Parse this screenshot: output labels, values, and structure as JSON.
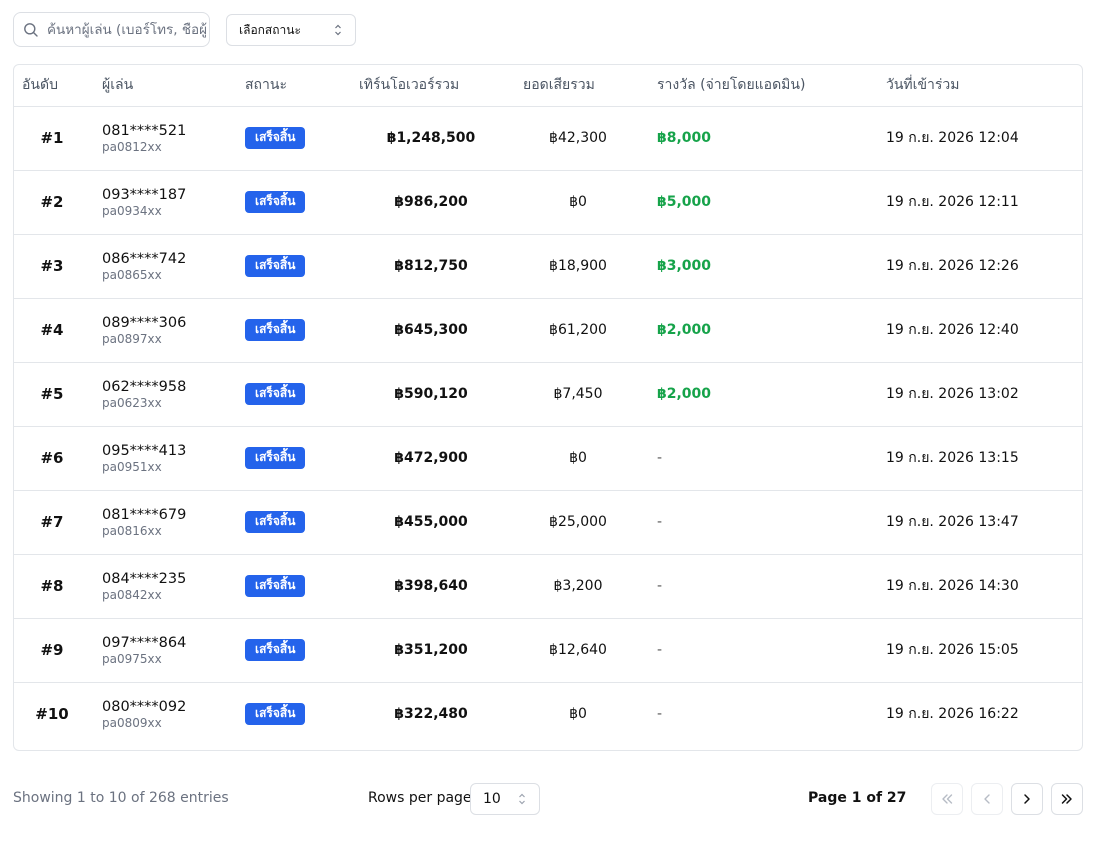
{
  "search": {
    "placeholder": "ค้นหาผู้เล่น (เบอร์โทร, ชื่อผู้ใช้)"
  },
  "status_filter": {
    "label": "เลือกสถานะ"
  },
  "table": {
    "headers": {
      "rank": "อันดับ",
      "player": "ผู้เล่น",
      "status": "สถานะ",
      "turnover": "เทิร์นโอเวอร์รวม",
      "loss": "ยอดเสียรวม",
      "prize": "รางวัล (จ่ายโดยแอดมิน)",
      "joined": "วันที่เข้าร่วม"
    },
    "rows": [
      {
        "rank": "#1",
        "phone": "081****521",
        "username": "pa0812xx",
        "status": "เสร็จสิ้น",
        "turnover": "฿1,248,500",
        "loss": "฿42,300",
        "prize": "฿8,000",
        "joined": "19 ก.ย. 2026 12:04"
      },
      {
        "rank": "#2",
        "phone": "093****187",
        "username": "pa0934xx",
        "status": "เสร็จสิ้น",
        "turnover": "฿986,200",
        "loss": "฿0",
        "prize": "฿5,000",
        "joined": "19 ก.ย. 2026 12:11"
      },
      {
        "rank": "#3",
        "phone": "086****742",
        "username": "pa0865xx",
        "status": "เสร็จสิ้น",
        "turnover": "฿812,750",
        "loss": "฿18,900",
        "prize": "฿3,000",
        "joined": "19 ก.ย. 2026 12:26"
      },
      {
        "rank": "#4",
        "phone": "089****306",
        "username": "pa0897xx",
        "status": "เสร็จสิ้น",
        "turnover": "฿645,300",
        "loss": "฿61,200",
        "prize": "฿2,000",
        "joined": "19 ก.ย. 2026 12:40"
      },
      {
        "rank": "#5",
        "phone": "062****958",
        "username": "pa0623xx",
        "status": "เสร็จสิ้น",
        "turnover": "฿590,120",
        "loss": "฿7,450",
        "prize": "฿2,000",
        "joined": "19 ก.ย. 2026 13:02"
      },
      {
        "rank": "#6",
        "phone": "095****413",
        "username": "pa0951xx",
        "status": "เสร็จสิ้น",
        "turnover": "฿472,900",
        "loss": "฿0",
        "prize": "-",
        "joined": "19 ก.ย. 2026 13:15"
      },
      {
        "rank": "#7",
        "phone": "081****679",
        "username": "pa0816xx",
        "status": "เสร็จสิ้น",
        "turnover": "฿455,000",
        "loss": "฿25,000",
        "prize": "-",
        "joined": "19 ก.ย. 2026 13:47"
      },
      {
        "rank": "#8",
        "phone": "084****235",
        "username": "pa0842xx",
        "status": "เสร็จสิ้น",
        "turnover": "฿398,640",
        "loss": "฿3,200",
        "prize": "-",
        "joined": "19 ก.ย. 2026 14:30"
      },
      {
        "rank": "#9",
        "phone": "097****864",
        "username": "pa0975xx",
        "status": "เสร็จสิ้น",
        "turnover": "฿351,200",
        "loss": "฿12,640",
        "prize": "-",
        "joined": "19 ก.ย. 2026 15:05"
      },
      {
        "rank": "#10",
        "phone": "080****092",
        "username": "pa0809xx",
        "status": "เสร็จสิ้น",
        "turnover": "฿322,480",
        "loss": "฿0",
        "prize": "-",
        "joined": "19 ก.ย. 2026 16:22"
      }
    ]
  },
  "footer": {
    "entries_text": "Showing 1 to 10 of 268 entries",
    "rows_per_page_label": "Rows per page",
    "rows_per_page_value": "10",
    "page_text": "Page 1 of 27"
  },
  "icons": {
    "search": "search-icon",
    "select": "chevron-updown-icon",
    "first": "chevrons-left-icon",
    "prev": "chevron-left-icon",
    "next": "chevron-right-icon",
    "last": "chevrons-right-icon"
  },
  "colors": {
    "badge": "#2463eb",
    "prize": "#16a34a",
    "border": "#e3e6ea",
    "muted_text": "#6b7280"
  }
}
